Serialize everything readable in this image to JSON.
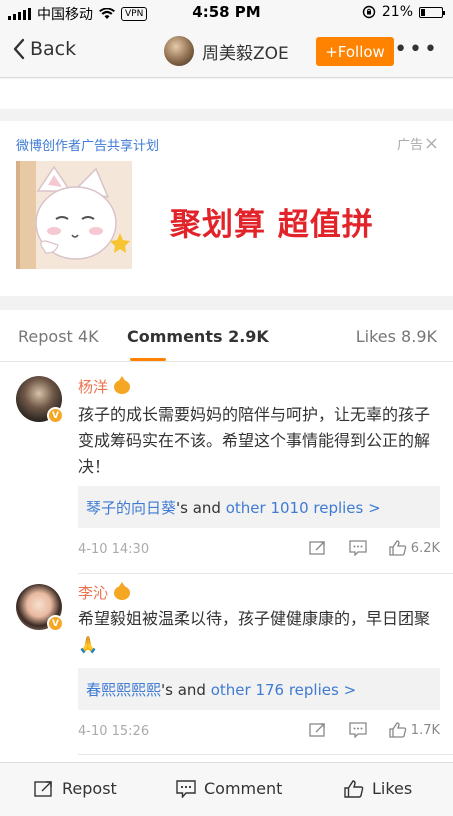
{
  "status_bar": {
    "carrier": "中国移动",
    "vpn": "VPN",
    "time": "4:58 PM",
    "battery": "21%",
    "battery_level": 0.21
  },
  "nav": {
    "back_label": "Back",
    "title": "周美毅ZOE",
    "follow_label": "+Follow",
    "more": "•••"
  },
  "ad": {
    "label": "微博创作者广告共享计划",
    "tag": "广告",
    "slogan": "聚划算 超值拼"
  },
  "tabs": [
    {
      "label": "Repost 4K"
    },
    {
      "label": "Comments 2.9K"
    },
    {
      "label": "Likes 8.9K"
    }
  ],
  "comments": [
    {
      "name": "杨洋",
      "text": "孩子的成长需要妈妈的陪伴与呵护，让无辜的孩子变成筹码实在不该。希望这个事情能得到公正的解决！",
      "reply_user": "琴子的向日葵",
      "reply_suffix": "'s and ",
      "reply_more": "other 1010 replies >",
      "time": "4-10 14:30",
      "likes": "6.2K"
    },
    {
      "name": "李沁",
      "text": "希望毅姐被温柔以待，孩子健健康康的，早日团聚🙏",
      "reply_user": "春熙熙熙熙",
      "reply_suffix": "'s and ",
      "reply_more": "other 176 replies >",
      "time": "4-10 15:26",
      "likes": "1.7K"
    }
  ],
  "bottom_bar": {
    "repost": "Repost",
    "comment": "Comment",
    "likes": "Likes"
  },
  "colors": {
    "accent": "#ff8200",
    "link": "#3f7bd4",
    "name": "#eb7350",
    "ad_red": "#e2232a"
  }
}
